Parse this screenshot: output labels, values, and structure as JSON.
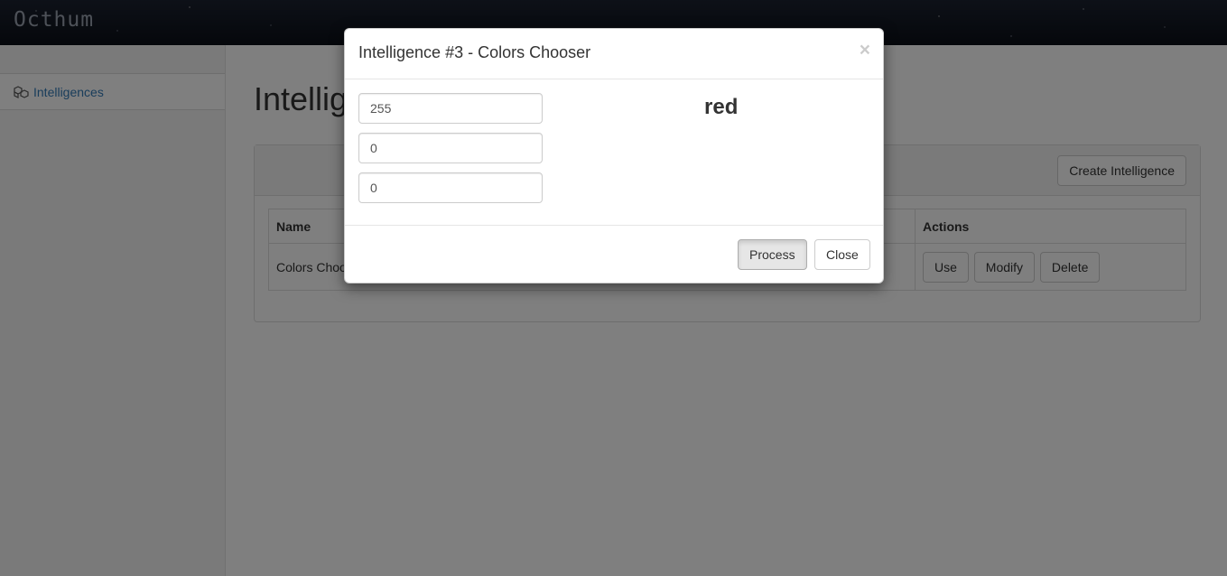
{
  "app": {
    "brand": "Octhum"
  },
  "sidebar": {
    "items": [
      {
        "label": "Intelligences",
        "icon": "cubes-icon"
      }
    ]
  },
  "main": {
    "title": "Intelligences",
    "create_button": "Create Intelligence",
    "table": {
      "headers": {
        "name": "Name",
        "actions": "Actions"
      },
      "rows": [
        {
          "name": "Colors Chooser",
          "use": "Use",
          "modify": "Modify",
          "delete": "Delete"
        }
      ]
    }
  },
  "modal": {
    "title": "Intelligence #3 - Colors Chooser",
    "close_symbol": "×",
    "inputs": [
      {
        "value": "255"
      },
      {
        "value": "0"
      },
      {
        "value": "0"
      }
    ],
    "result": "red",
    "process_button": "Process",
    "close_button": "Close"
  }
}
